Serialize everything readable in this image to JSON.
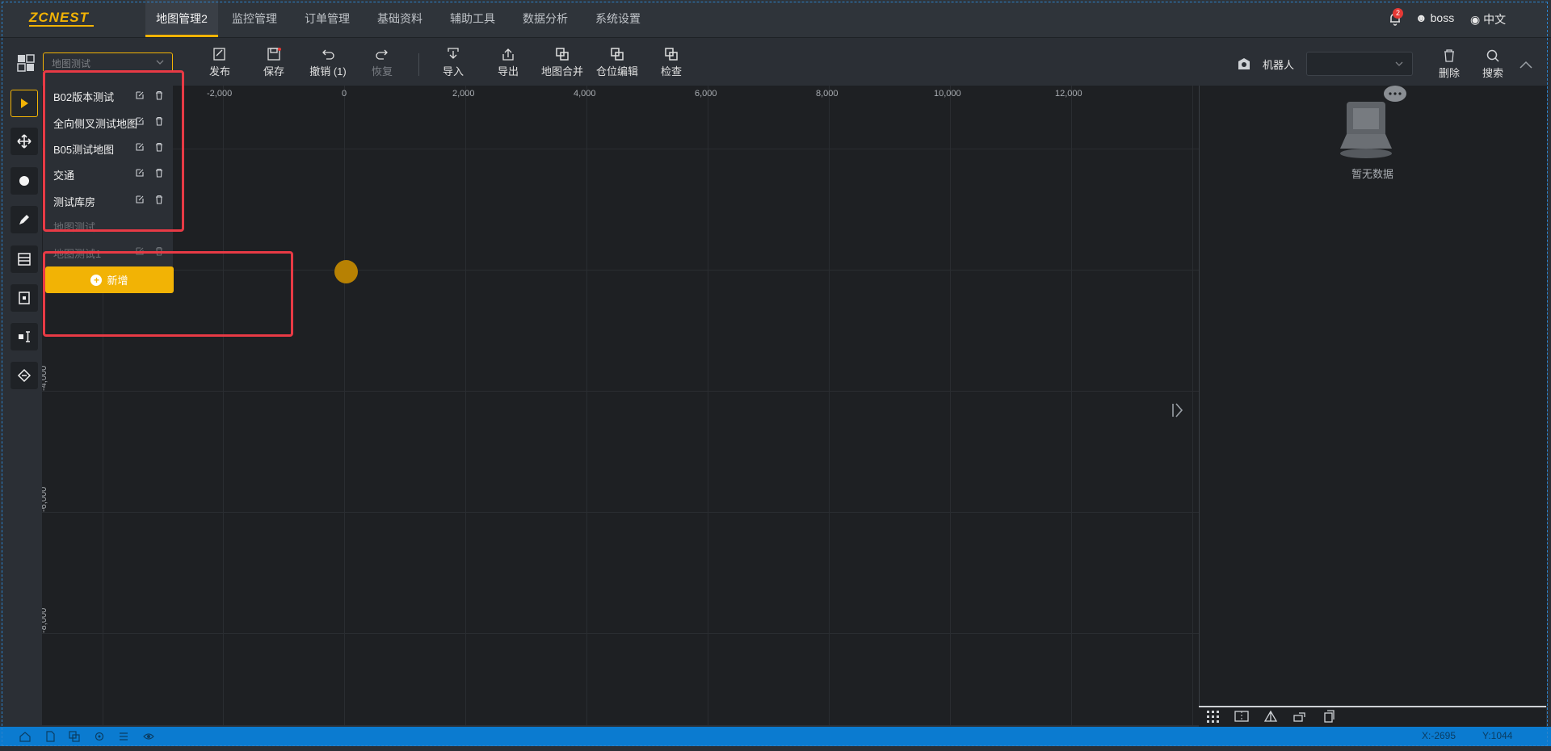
{
  "app": {
    "logo": "ZCNEST"
  },
  "nav": {
    "tabs": [
      {
        "label": "地图管理2"
      },
      {
        "label": "监控管理"
      },
      {
        "label": "订单管理"
      },
      {
        "label": "基础资料"
      },
      {
        "label": "辅助工具"
      },
      {
        "label": "数据分析"
      },
      {
        "label": "系统设置"
      }
    ],
    "notification_count": "2",
    "user": "boss",
    "language": "中文"
  },
  "toolbar": {
    "map_select_placeholder": "地图测试",
    "tools": {
      "publish": "发布",
      "save": "保存",
      "undo": "撤销 (1)",
      "redo": "恢复",
      "import": "导入",
      "export": "导出",
      "merge": "地图合并",
      "slot_edit": "仓位编辑",
      "check": "检查"
    },
    "robot_label": "机器人",
    "right_tools": {
      "delete": "删除",
      "search": "搜索"
    }
  },
  "dropdown": {
    "items": [
      {
        "label": "B02版本测试"
      },
      {
        "label": "全向侧叉测试地图"
      },
      {
        "label": "B05测试地图"
      },
      {
        "label": "交通"
      },
      {
        "label": "测试库房"
      },
      {
        "label": "地图测试"
      },
      {
        "label": "地图测试1"
      }
    ],
    "add_label": "新增"
  },
  "canvas": {
    "x_ticks": [
      "-2,000",
      "0",
      "2,000",
      "4,000",
      "6,000",
      "8,000",
      "10,000",
      "12,000"
    ],
    "y_ticks": [
      "-4,000",
      "-6,000",
      "-8,000"
    ]
  },
  "right_panel": {
    "empty_text": "暂无数据"
  },
  "status": {
    "x": "X:-2695",
    "y": "Y:1044"
  },
  "colors": {
    "accent": "#f2b305",
    "statusbar": "#0b7bd0",
    "annotation": "#e83a45"
  }
}
